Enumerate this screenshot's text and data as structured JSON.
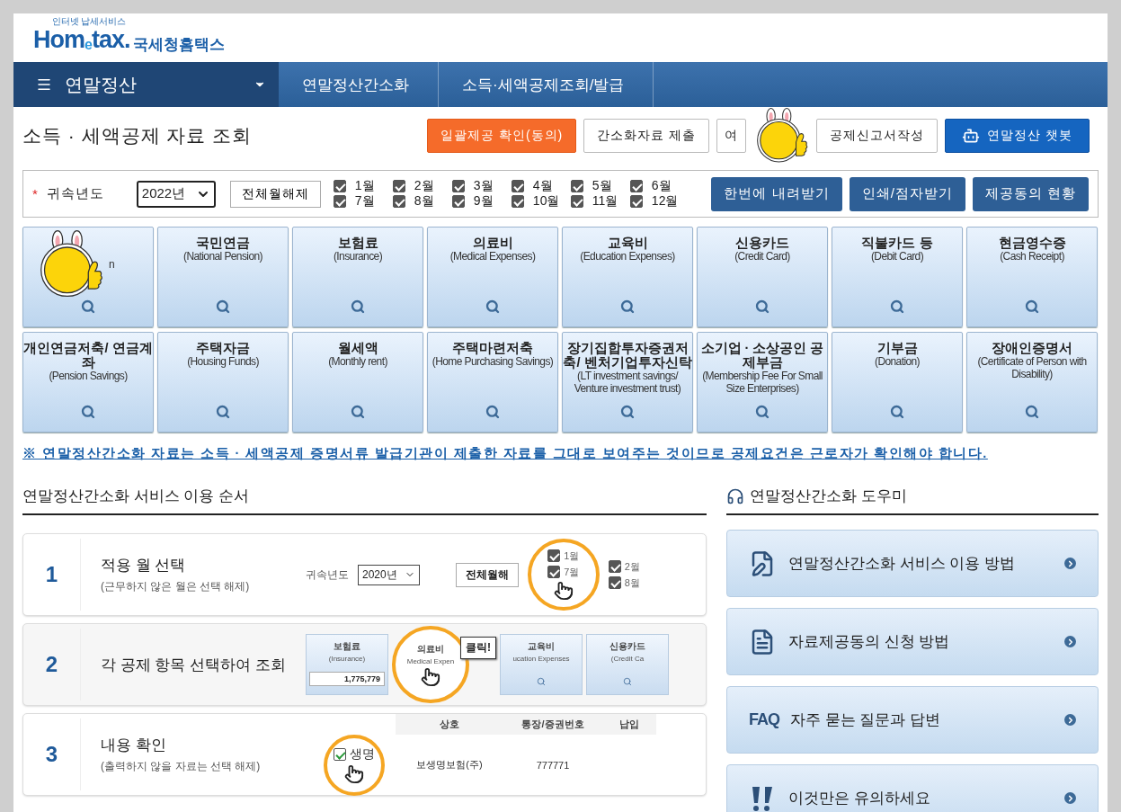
{
  "header": {
    "tagline": "인터넷 납세서비스",
    "logo": "Hom$_{e}$tax.",
    "logo_korean": "국세청홈택스"
  },
  "nav": {
    "menu": "연말정산",
    "crumbs": [
      "연말정산간소화",
      "소득·세액공제조회/발급"
    ]
  },
  "page_title": "소득 · 세액공제 자료 조회",
  "top_buttons": [
    {
      "label": "일괄제공 확인(동의)",
      "kind": "primary"
    },
    {
      "label": "간소화자료 제출",
      "kind": "plain"
    },
    {
      "label": "여",
      "kind": "clipped"
    },
    {
      "label": "공제신고서작성",
      "kind": "plain"
    },
    {
      "label": "연말정산 챗봇",
      "kind": "chatbot"
    }
  ],
  "filter": {
    "required_mark": "*",
    "year_label": "귀속년도",
    "year": "2022년",
    "clear_button": "전체월해제",
    "months": [
      {
        "label": "1월",
        "checked": true
      },
      {
        "label": "2월",
        "checked": true
      },
      {
        "label": "3월",
        "checked": true
      },
      {
        "label": "4월",
        "checked": true
      },
      {
        "label": "5월",
        "checked": true
      },
      {
        "label": "6월",
        "checked": true
      },
      {
        "label": "7월",
        "checked": true
      },
      {
        "label": "8월",
        "checked": true
      },
      {
        "label": "9월",
        "checked": true
      },
      {
        "label": "10월",
        "checked": true
      },
      {
        "label": "11월",
        "checked": true
      },
      {
        "label": "12월",
        "checked": true
      }
    ],
    "actions": [
      "한번에 내려받기",
      "인쇄/점자받기",
      "제공동의 현황"
    ]
  },
  "tiles": [
    {
      "subtitle": "n",
      "kind": "mascot"
    },
    {
      "title": "국민연금",
      "subtitle": "(National Pension)",
      "kind": "plain"
    },
    {
      "title": "보험료",
      "subtitle": "(Insurance)",
      "kind": "plain"
    },
    {
      "title": "의료비",
      "subtitle": "(Medical Expenses)",
      "kind": "plain"
    },
    {
      "title": "교육비",
      "subtitle": "(Education Expenses)",
      "kind": "plain"
    },
    {
      "title": "신용카드",
      "subtitle": "(Credit Card)",
      "kind": "plain"
    },
    {
      "title": "직불카드 등",
      "subtitle": "(Debit Card)",
      "kind": "plain"
    },
    {
      "title": "현금영수증",
      "subtitle": "(Cash Receipt)",
      "kind": "plain"
    },
    {
      "title": "개인연금저축/ 연금계좌",
      "subtitle": "(Pension Savings)",
      "kind": "plain"
    },
    {
      "title": "주택자금",
      "subtitle": "(Housing Funds)",
      "kind": "plain"
    },
    {
      "title": "월세액",
      "subtitle": "(Monthly rent)",
      "kind": "plain"
    },
    {
      "title": "주택마련저축",
      "subtitle": "(Home Purchasing Savings)",
      "kind": "plain"
    },
    {
      "title": "장기집합투자증권저축/ 벤처기업투자신탁",
      "subtitle": "(LT investment savings/ Venture investment trust)",
      "kind": "plain"
    },
    {
      "title": "소기업 · 소상공인 공제부금",
      "subtitle": "(Membership Fee For Small Size Enterprises)",
      "kind": "plain"
    },
    {
      "title": "기부금",
      "subtitle": "(Donation)",
      "kind": "plain"
    },
    {
      "title": "장애인증명서",
      "subtitle": "(Certificate of Person with Disability)",
      "kind": "plain"
    }
  ],
  "notice": "※ 연말정산간소화 자료는 소득 · 세액공제 증명서류 발급기관이 제출한 자료를 그대로 보여주는 것이므로 공제요건은 근로자가 확인해야 합니다.",
  "steps_title": "연말정산간소화 서비스 이용 순서",
  "steps": [
    {
      "number": "1",
      "title": "적용 월 선택",
      "note": "(근무하지 않은 월은 선택 해제)",
      "kind": "months",
      "preview": {
        "year_label": "귀속년도",
        "year": "2020년",
        "clear_button": "전체월해",
        "months": [
          {
            "label": "1월",
            "checked": true
          },
          {
            "label": "7월",
            "checked": true
          },
          {
            "label": "2월",
            "checked": true
          },
          {
            "label": "8월",
            "checked": true
          }
        ]
      }
    },
    {
      "number": "2",
      "title": "각 공제 항목 선택하여 조회",
      "kind": "tiles",
      "preview": {
        "callout": "클릭!",
        "tiles": [
          {
            "title": "보험료",
            "subtitle": "(Insurance)",
            "amount": "1,775,779"
          },
          {
            "title": "의료비",
            "subtitle": "Medical Expen"
          },
          {
            "title": "교육비",
            "subtitle": "ucation Expenses"
          },
          {
            "title": "신용카드",
            "subtitle": "(Credit Ca"
          }
        ]
      }
    },
    {
      "number": "3",
      "title": "내용 확인",
      "note": "(출력하지 않을 자료는 선택 해제)",
      "kind": "table",
      "preview": {
        "columns": [
          "상호",
          "통장/증권번호",
          "납입"
        ],
        "rows": [
          {
            "checked": true,
            "magnified": "생명",
            "cells": [
              "보생명보험(주)",
              "777771"
            ]
          }
        ]
      }
    }
  ],
  "helper_title": "연말정산간소화 도우미",
  "helper_items": [
    {
      "label": "연말정산간소화 서비스 이용 방법",
      "kind": "edit"
    },
    {
      "label": "자료제공동의 신청 방법",
      "kind": "doc"
    },
    {
      "label": "자주 묻는 질문과 답변",
      "kind": "faq",
      "badge": "FAQ"
    },
    {
      "label": "이것만은 유의하세요",
      "kind": "alert"
    }
  ]
}
